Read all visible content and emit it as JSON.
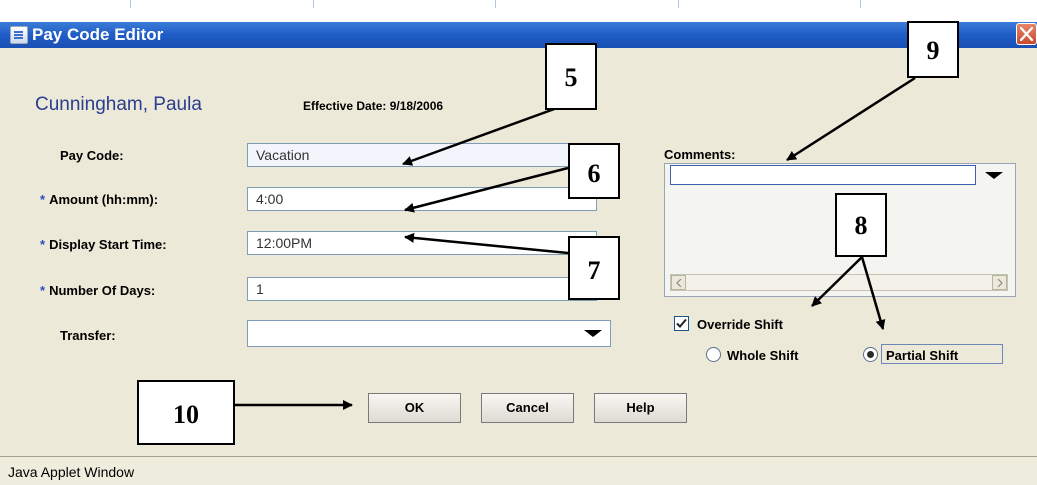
{
  "window": {
    "title": "Pay Code Editor"
  },
  "employee": {
    "name": "Cunningham, Paula",
    "effective_date": "Effective Date: 9/18/2006"
  },
  "form": {
    "pay_code": {
      "label": "Pay Code:",
      "value": "Vacation"
    },
    "amount": {
      "label": "Amount (hh:mm):",
      "value": "4:00"
    },
    "display_start_time": {
      "label": "Display Start Time:",
      "value": "12:00PM"
    },
    "number_of_days": {
      "label": "Number Of Days:",
      "value": "1"
    },
    "transfer": {
      "label": "Transfer:",
      "value": ""
    },
    "required_marker": "*"
  },
  "comments": {
    "label": "Comments:",
    "value": ""
  },
  "shift": {
    "override_label": "Override Shift",
    "override_checked": true,
    "whole_label": "Whole Shift",
    "partial_label": "Partial Shift",
    "selected": "partial"
  },
  "buttons": {
    "ok": "OK",
    "cancel": "Cancel",
    "help": "Help"
  },
  "callouts": {
    "c5": "5",
    "c6": "6",
    "c7": "7",
    "c8": "8",
    "c9": "9",
    "c10": "10"
  },
  "status": {
    "text": "Java Applet Window"
  },
  "icons": {
    "app": "document-icon",
    "close": "close-icon",
    "dropdown": "chevron-down-icon",
    "scroll_left": "arrow-left-icon",
    "scroll_right": "arrow-right-icon",
    "check": "check-icon"
  }
}
